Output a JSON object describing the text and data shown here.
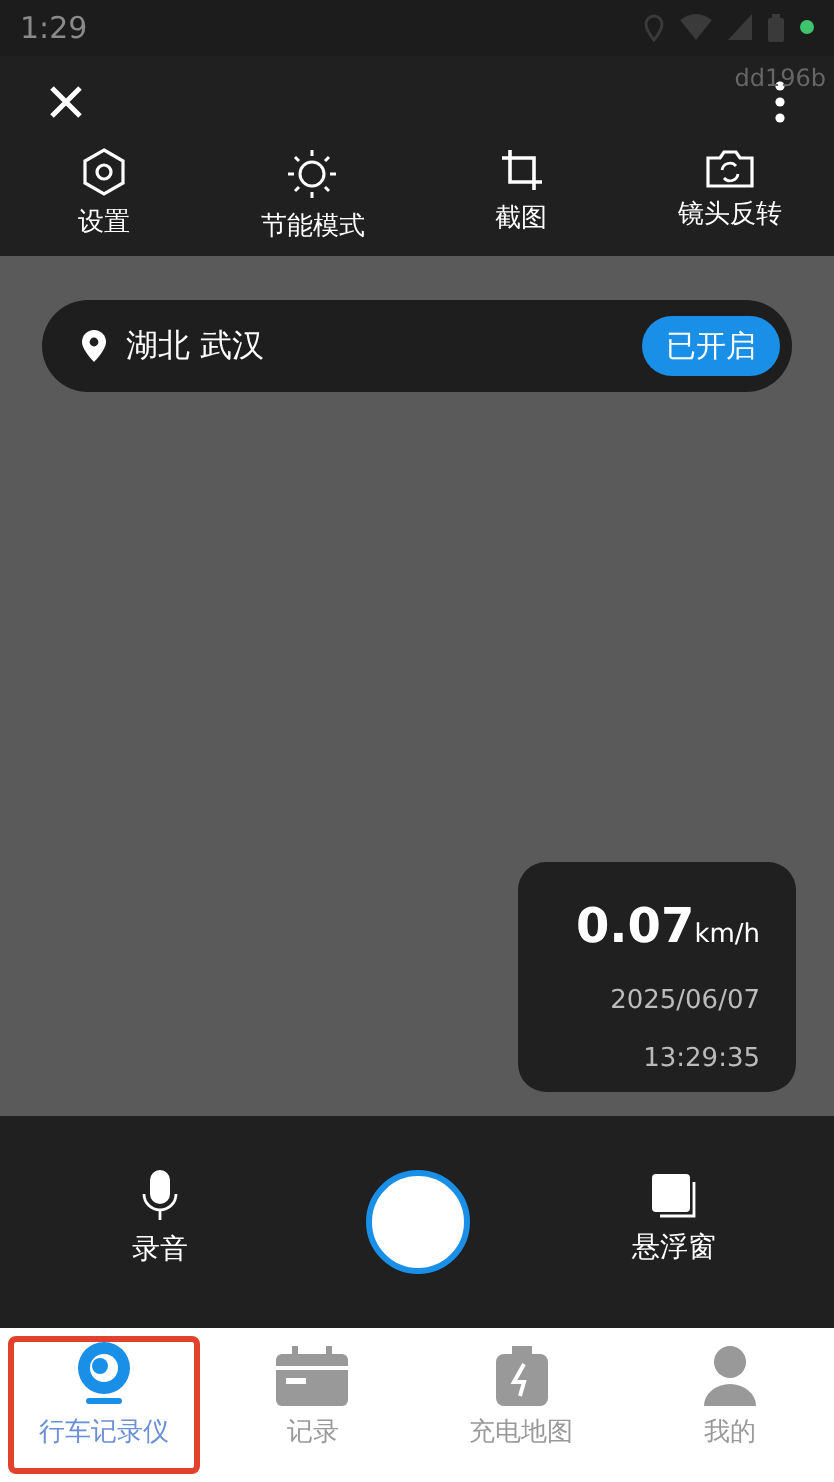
{
  "status_bar": {
    "time": "1:29"
  },
  "header": {
    "device_id": "dd196b"
  },
  "toolbar": [
    {
      "kind": "settings",
      "label": "设置"
    },
    {
      "kind": "sun",
      "label": "节能模式"
    },
    {
      "kind": "crop",
      "label": "截图"
    },
    {
      "kind": "flip",
      "label": "镜头反转"
    }
  ],
  "location": {
    "text": "湖北 武汉",
    "badge": "已开启"
  },
  "speed_card": {
    "speed": "0.07",
    "unit": "km/h",
    "date": "2025/06/07",
    "time": "13:29:35"
  },
  "controls": [
    {
      "kind": "mic",
      "label": "录音"
    },
    {
      "kind": "window",
      "label": "悬浮窗"
    }
  ],
  "nav": [
    {
      "kind": "camera",
      "label": "行车记录仪",
      "selected": true,
      "highlighted": true
    },
    {
      "kind": "calendar",
      "label": "记录",
      "selected": false,
      "highlighted": false
    },
    {
      "kind": "battery",
      "label": "充电地图",
      "selected": false,
      "highlighted": false
    },
    {
      "kind": "person",
      "label": "我的",
      "selected": false,
      "highlighted": false
    }
  ]
}
